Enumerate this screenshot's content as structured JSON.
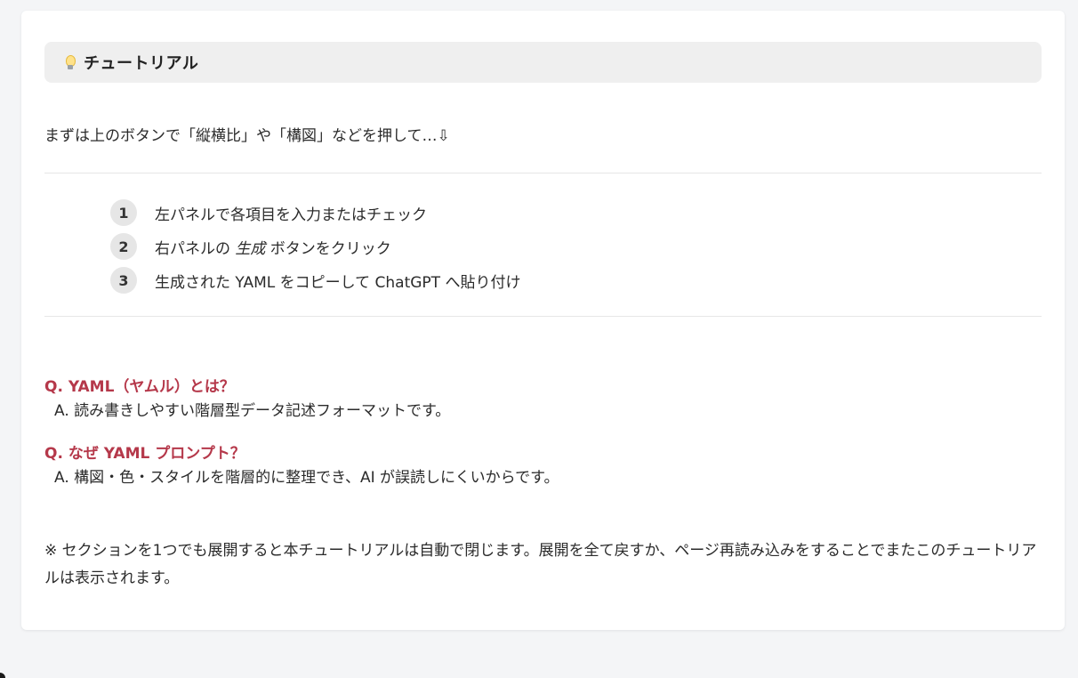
{
  "tutorial": {
    "icon": "lightbulb-icon",
    "title": "チュートリアル",
    "intro": "まずは上のボタンで「縦横比」や「構図」などを押して…⇩",
    "steps": [
      {
        "number": "1",
        "text": "左パネルで各項目を入力またはチェック"
      },
      {
        "number": "2",
        "text_before": "右パネルの ",
        "text_em": "生成",
        "text_after": " ボタンをクリック"
      },
      {
        "number": "3",
        "text": "生成された YAML をコピーして ChatGPT へ貼り付け"
      }
    ],
    "faq": [
      {
        "question": "Q. YAML（ヤムル）とは？",
        "answer": "A. 読み書きしやすい階層型データ記述フォーマットです。"
      },
      {
        "question": "Q. なぜ YAML プロンプト？",
        "answer": "A. 構図・色・スタイルを階層的に整理でき、AI が誤読しにくいからです。"
      }
    ],
    "note": "※ セクションを1つでも展開すると本チュートリアルは自動で閉じます。展開を全て戻すか、ページ再読み込みをすることでまたこのチュートリアルは表示されます。"
  },
  "colors": {
    "question": "#b5384a",
    "header_bg": "#efefef",
    "page_bg": "#f4f5f7"
  }
}
